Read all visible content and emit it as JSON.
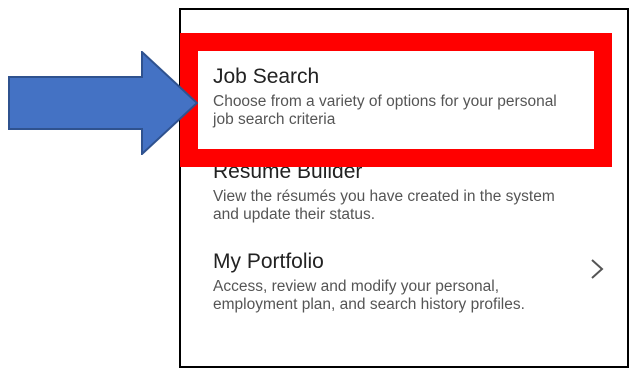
{
  "menu": {
    "items": [
      {
        "title": "Job Search",
        "description": "Choose from a variety of options for your personal job search criteria"
      },
      {
        "title": "Résumé Builder",
        "description": "View the résumés you have created in the system and update their status."
      },
      {
        "title": "My Portfolio",
        "description": "Access, review and modify your personal, employment plan, and search history profiles."
      }
    ]
  },
  "icons": {
    "arrow": "arrow-right-icon",
    "chevron": "chevron-right-icon"
  },
  "colors": {
    "highlight": "#ff0000",
    "arrow_fill": "#4472c4",
    "arrow_stroke": "#2f528f",
    "title_text": "#222222",
    "desc_text": "#555555"
  }
}
